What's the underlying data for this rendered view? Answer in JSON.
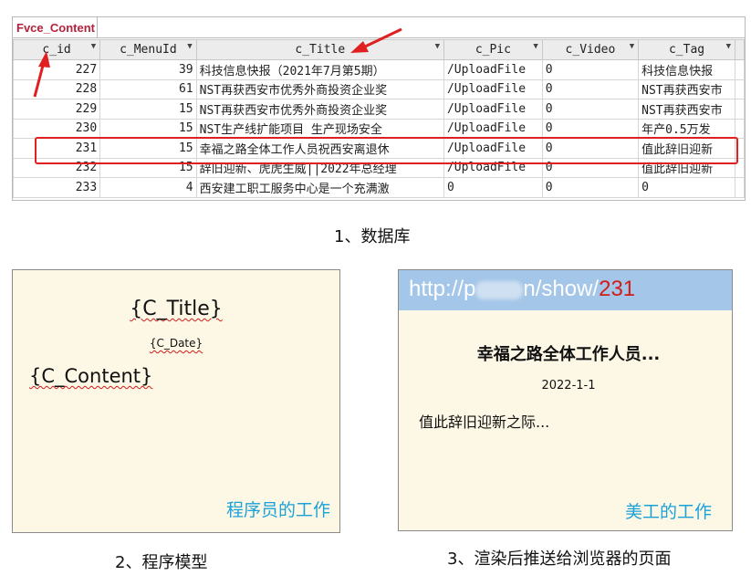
{
  "database": {
    "tab_label": "Fvce_Content",
    "columns": [
      "c_id",
      "c_MenuId",
      "c_Title",
      "c_Pic",
      "c_Video",
      "c_Tag"
    ],
    "rows": [
      [
        "227",
        "39",
        "科技信息快报（2021年7月第5期）",
        "/UploadFile",
        "0",
        "科技信息快报"
      ],
      [
        "228",
        "61",
        "NST再获西安市优秀外商投资企业奖",
        "/UploadFile",
        "0",
        "NST再获西安市"
      ],
      [
        "229",
        "15",
        "NST再获西安市优秀外商投资企业奖",
        "/UploadFile",
        "0",
        "NST再获西安市"
      ],
      [
        "230",
        "15",
        "NST生产线扩能项目  生产现场安全",
        "/UploadFile",
        "0",
        "年产0.5万发"
      ],
      [
        "231",
        "15",
        "幸福之路全体工作人员祝西安离退休",
        "/UploadFile",
        "0",
        "值此辞旧迎新"
      ],
      [
        "232",
        "15",
        "辞旧迎新、虎虎生威||2022年总经理",
        "/UploadFile",
        "0",
        "值此辞旧迎新"
      ],
      [
        "233",
        "4",
        "西安建工职工服务中心是一个充满激",
        "0",
        "0",
        "0"
      ]
    ],
    "caption": "1、数据库"
  },
  "template": {
    "title_placeholder": "{C_Title}",
    "date_placeholder": "{C_Date}",
    "content_placeholder": "{C_Content}",
    "role_note": "程序员的工作",
    "caption": "2、程序模型"
  },
  "rendered": {
    "url_prefix": "http://p",
    "url_suffix": "n/show/",
    "url_id": "231",
    "title": "幸福之路全体工作人员...",
    "date": "2022-1-1",
    "content": "值此辞旧迎新之际...",
    "role_note": "美工的工作",
    "caption": "3、渲染后推送给浏览器的页面"
  },
  "colors": {
    "highlight": "#e02020",
    "arrow": "#e02020",
    "accent_blue": "#1aa2d8",
    "url_bar": "#a4c6e8"
  }
}
